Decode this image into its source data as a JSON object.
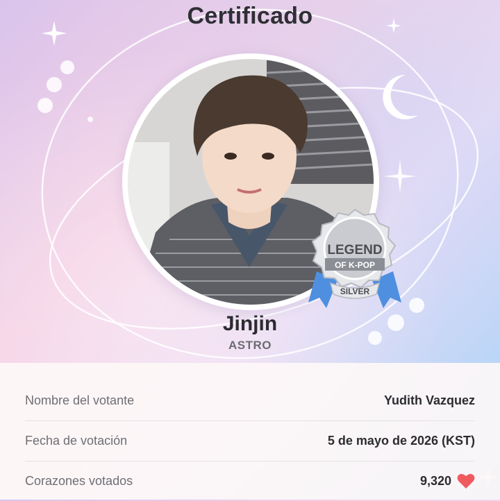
{
  "header": {
    "title": "Certificado"
  },
  "artist": {
    "name": "Jinjin",
    "group": "ASTRO"
  },
  "badge": {
    "line1": "LEGEND",
    "line2": "OF K-POP",
    "tier": "SILVER"
  },
  "details": [
    {
      "label": "Nombre del votante",
      "value": "Yudith Vazquez"
    },
    {
      "label": "Fecha de votación",
      "value": "5 de mayo de 2026 (KST)"
    },
    {
      "label": "Corazones votados",
      "value": "9,320"
    }
  ],
  "icons": {
    "heart": "heart-icon",
    "moon": "crescent-moon-icon",
    "star": "sparkle-icon"
  },
  "colors": {
    "heart": "#ef5a5f",
    "ribbon": "#4f8fe0",
    "medal": "#c9cbd1",
    "title": "#2f2f35"
  }
}
